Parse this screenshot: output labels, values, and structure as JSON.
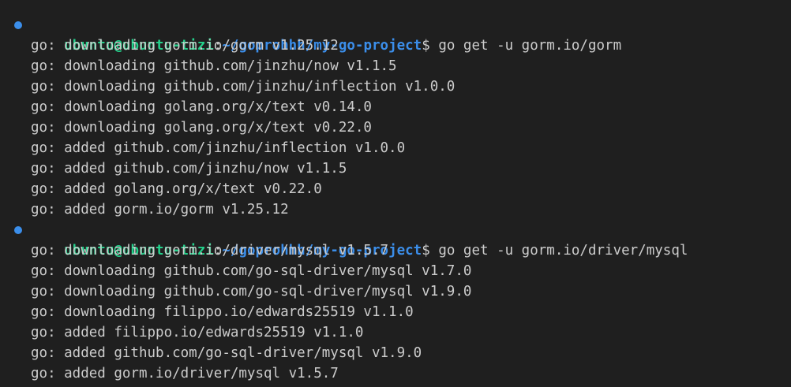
{
  "blocks": [
    {
      "prompt": {
        "user_host": "ubuntu@ubuntu-tizi",
        "colon": ":",
        "path": "~/goprohhh/my-go-project",
        "dollar": "$",
        "command": " go get -u gorm.io/gorm"
      },
      "output": [
        "go: downloading gorm.io/gorm v1.25.12",
        "go: downloading github.com/jinzhu/now v1.1.5",
        "go: downloading github.com/jinzhu/inflection v1.0.0",
        "go: downloading golang.org/x/text v0.14.0",
        "go: downloading golang.org/x/text v0.22.0",
        "go: added github.com/jinzhu/inflection v1.0.0",
        "go: added github.com/jinzhu/now v1.1.5",
        "go: added golang.org/x/text v0.22.0",
        "go: added gorm.io/gorm v1.25.12"
      ]
    },
    {
      "prompt": {
        "user_host": "ubuntu@ubuntu-tizi",
        "colon": ":",
        "path": "~/goprohhh/my-go-project",
        "dollar": "$",
        "command": " go get -u gorm.io/driver/mysql"
      },
      "output": [
        "go: downloading gorm.io/driver/mysql v1.5.7",
        "go: downloading github.com/go-sql-driver/mysql v1.7.0",
        "go: downloading github.com/go-sql-driver/mysql v1.9.0",
        "go: downloading filippo.io/edwards25519 v1.1.0",
        "go: added filippo.io/edwards25519 v1.1.0",
        "go: added github.com/go-sql-driver/mysql v1.9.0",
        "go: added gorm.io/driver/mysql v1.5.7"
      ]
    }
  ],
  "colors": {
    "background": "#1f1f1f",
    "text": "#cccccc",
    "user_host": "#23d18b",
    "path": "#3b8eea",
    "marker": "#3b8eea"
  },
  "icons": {
    "command_marker": "command-decoration-icon"
  }
}
